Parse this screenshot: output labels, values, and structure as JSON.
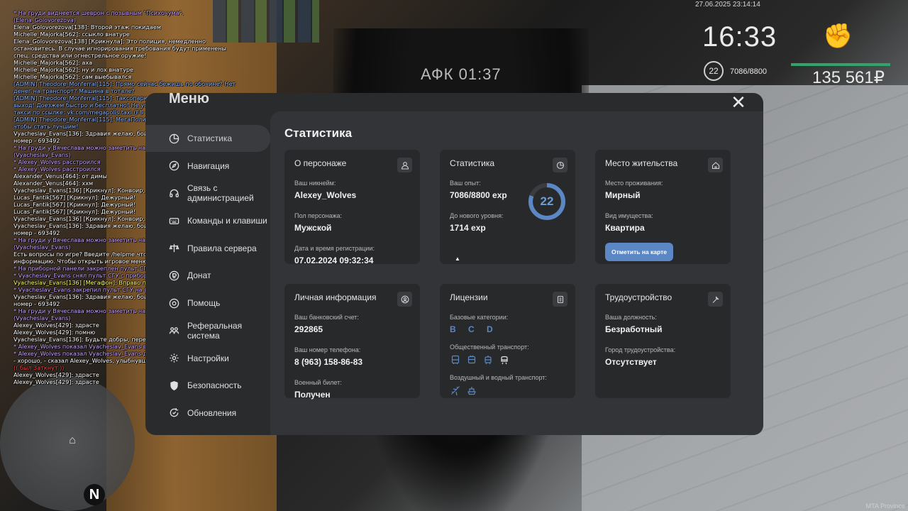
{
  "hud": {
    "datetime": "27.06.2025 23:14:14",
    "time": "16:33",
    "level": "22",
    "exp": "7086/8800",
    "money": "135 561₽",
    "afk": "АФК 01:37"
  },
  "chat": [
    {
      "text": "* На груди виднеется шеврон с позывным \"Психочума\". (Elena_Golovorezova)",
      "color": "#c9a6ff"
    },
    {
      "text": "Elena_Golovorezova[138]: Второй этаж покидаем",
      "color": "#ffffff"
    },
    {
      "text": "Michelle_Majorka[562]: ссыкло внатуре",
      "color": "#ffffff"
    },
    {
      "text": "Elena_Golovorezova[138] [Крикнула]: Это полиция, немедленно остановитесь. В случае игнорирования требования будут применены спец. средства или огнестрельное оружие!",
      "color": "#ffffff"
    },
    {
      "text": "Michelle_Majorka[562]: аха",
      "color": "#ffffff"
    },
    {
      "text": "Michelle_Majorka[562]: ну и лох внатуре",
      "color": "#ffffff"
    },
    {
      "text": "Michelle_Majorka[562]: сам выебывался",
      "color": "#ffffff"
    },
    {
      "text": "[ADMIN] Theodore_Monferral[115]: Прямо сейчас бежишь по обочине? Нет денег на транспорт? Машина в тотале?",
      "color": "#8fb8ff"
    },
    {
      "text": "[ADMIN] Theodore_Monferral[115]: Таксопарк МегаПолис — это твой выход! Доезжем быстро и бесплатно! Не упусти свой шанс, заказывай такси по ссылке: vk.com/megapolis.taxi (F8 - Ctrl+C > Ctrl+V)",
      "color": "#8fb8ff"
    },
    {
      "text": "[ADMIN] Theodore_Monferral[115]: МегаПолис не опять, а снова с нами, чтобы стать лучшим!",
      "color": "#8fb8ff"
    },
    {
      "text": "Vyacheslav_Evans[136]: Здравия желаю, бойцом ВНГ являюсь, мой личный номер - 693492",
      "color": "#ffffff"
    },
    {
      "text": "* На груди у Вячеслава можно заметить нашивку с позывным \"Зубр\". (Vyacheslav_Evans)",
      "color": "#c9a6ff"
    },
    {
      "text": "* Alexey_Wolves расстроился",
      "color": "#c9a6ff"
    },
    {
      "text": "* Alexey_Wolves расстроился",
      "color": "#c9a6ff"
    },
    {
      "text": "Alexander_Venus[464]: от димы",
      "color": "#ffffff"
    },
    {
      "text": "Alexander_Venus[464]: ххм",
      "color": "#ffffff"
    },
    {
      "text": "Vyacheslav_Evans[136] [Крикнул]: Конвоир, сюда!",
      "color": "#ffffff"
    },
    {
      "text": "Lucas_Fantik[567] [Крикнул]: Дежурный!",
      "color": "#ffffff"
    },
    {
      "text": "Lucas_Fantik[567] [Крикнул]: Дежурный!",
      "color": "#ffffff"
    },
    {
      "text": "Lucas_Fantik[567] [Крикнул]: Дежурный!",
      "color": "#ffffff"
    },
    {
      "text": "Vyacheslav_Evans[136] [Крикнул]: Конвоир, сюда!",
      "color": "#ffffff"
    },
    {
      "text": "Vyacheslav_Evans[136]: Здравия желаю, бойцом ВНГ являюсь, мой личный номер - 693492",
      "color": "#ffffff"
    },
    {
      "text": "* На груди у Вячеслава можно заметить нашивку с позывным \"Зубр\". (Vyacheslav_Evans)",
      "color": "#c9a6ff"
    },
    {
      "text": "Есть вопросы по игре? Введите /helpme чтобы получить нужную информацию. Чтобы открыть игровое меню, нажмите \"M\".",
      "color": "#ffffff"
    },
    {
      "text": "* На приборной панели закреплен пульт СГУ. (Vyacheslav_Evans)",
      "color": "#c9a6ff"
    },
    {
      "text": "* Vyacheslav_Evans снял пульт СГУ с приборной панели и что-то сказал",
      "color": "#c9a6ff"
    },
    {
      "text": "Vyacheslav_Evans[136] [Мегафон]: Вправо принимаем, останавливаемся!",
      "color": "#ffff66"
    },
    {
      "text": "* Vyacheslav_Evans закрепил пульт СГУ на приборной панели",
      "color": "#c9a6ff"
    },
    {
      "text": "Vyacheslav_Evans[136]: Здравия желаю, бойцом ВНГ являюсь, мой личный номер - 693492",
      "color": "#ffffff"
    },
    {
      "text": "* На груди у Вячеслава можно заметить нашивку с позывным \"Зубр\". (Vyacheslav_Evans)",
      "color": "#c9a6ff"
    },
    {
      "text": "Alexey_Wolves[429]: здрасте",
      "color": "#ffffff"
    },
    {
      "text": "Alexey_Wolves[429]: помню",
      "color": "#ffffff"
    },
    {
      "text": "Vyacheslav_Evans[136]: Будьте добры, передайте Ваши документы.",
      "color": "#ffffff"
    },
    {
      "text": "* Alexey_Wolves показал Vyacheslav_Evans водительское удостоверение",
      "color": "#c9a6ff"
    },
    {
      "text": "* Alexey_Wolves показал Vyacheslav_Evans документы на транспорт",
      "color": "#c9a6ff"
    },
    {
      "text": "- хорошо, - сказал Alexey_Wolves, улыбнувшись.",
      "color": "#ffffff"
    },
    {
      "text": "(( был Заткнут ))",
      "color": "#ff4444"
    },
    {
      "text": "Alexey_Wolves[429]: здрасте",
      "color": "#ffffff"
    },
    {
      "text": "Alexey_Wolves[429]: здрасте",
      "color": "#ffffff"
    }
  ],
  "menu": {
    "title": "Меню",
    "nav": [
      {
        "label": "Статистика",
        "icon": "stats-icon"
      },
      {
        "label": "Навигация",
        "icon": "compass-icon"
      },
      {
        "label": "Связь с администрацией",
        "icon": "headset-icon"
      },
      {
        "label": "Команды и клавиши",
        "icon": "keyboard-icon"
      },
      {
        "label": "Правила сервера",
        "icon": "rules-icon"
      },
      {
        "label": "Донат",
        "icon": "donate-icon"
      },
      {
        "label": "Помощь",
        "icon": "help-icon"
      },
      {
        "label": "Реферальная система",
        "icon": "referral-icon"
      },
      {
        "label": "Настройки",
        "icon": "gear-icon"
      },
      {
        "label": "Безопасность",
        "icon": "shield-icon"
      },
      {
        "label": "Обновления",
        "icon": "refresh-icon"
      }
    ]
  },
  "stats": {
    "title": "Статистика",
    "character": {
      "title": "О персонаже",
      "nickname_label": "Ваш никнейм:",
      "nickname": "Alexey_Wolves",
      "gender_label": "Пол персонажа:",
      "gender": "Мужской",
      "reg_label": "Дата и время регистрации:",
      "reg": "07.02.2024 09:32:34"
    },
    "statistics": {
      "title": "Статистика",
      "exp_label": "Ваш опыт:",
      "exp": "7086/8800 exp",
      "next_label": "До нового уровня:",
      "next": "1714 exp",
      "level": "22",
      "progress": 0.805
    },
    "residence": {
      "title": "Место жительства",
      "place_label": "Место проживания:",
      "place": "Мирный",
      "property_label": "Вид имущества:",
      "property": "Квартира",
      "button": "Отметить на карте"
    },
    "personal": {
      "title": "Личная информация",
      "bank_label": "Ваш банковский счет:",
      "bank": "292865",
      "phone_label": "Ваш номер телефона:",
      "phone": "8 (963) 158-86-83",
      "military_label": "Военный билет:",
      "military": "Получен"
    },
    "licenses": {
      "title": "Лицензии",
      "base_label": "Базовые категории:",
      "base": "B C D",
      "public_label": "Общественный транспорт:",
      "air_label": "Воздушный и водный транспорт:"
    },
    "employment": {
      "title": "Трудоустройство",
      "position_label": "Ваша должность:",
      "position": "Безработный",
      "city_label": "Город трудоустройства:",
      "city": "Отсутствует"
    }
  },
  "colors": {
    "accent": "#5b87c4",
    "panel": "#2a2b2d",
    "card": "#28292b"
  },
  "footer": "MTA Province"
}
